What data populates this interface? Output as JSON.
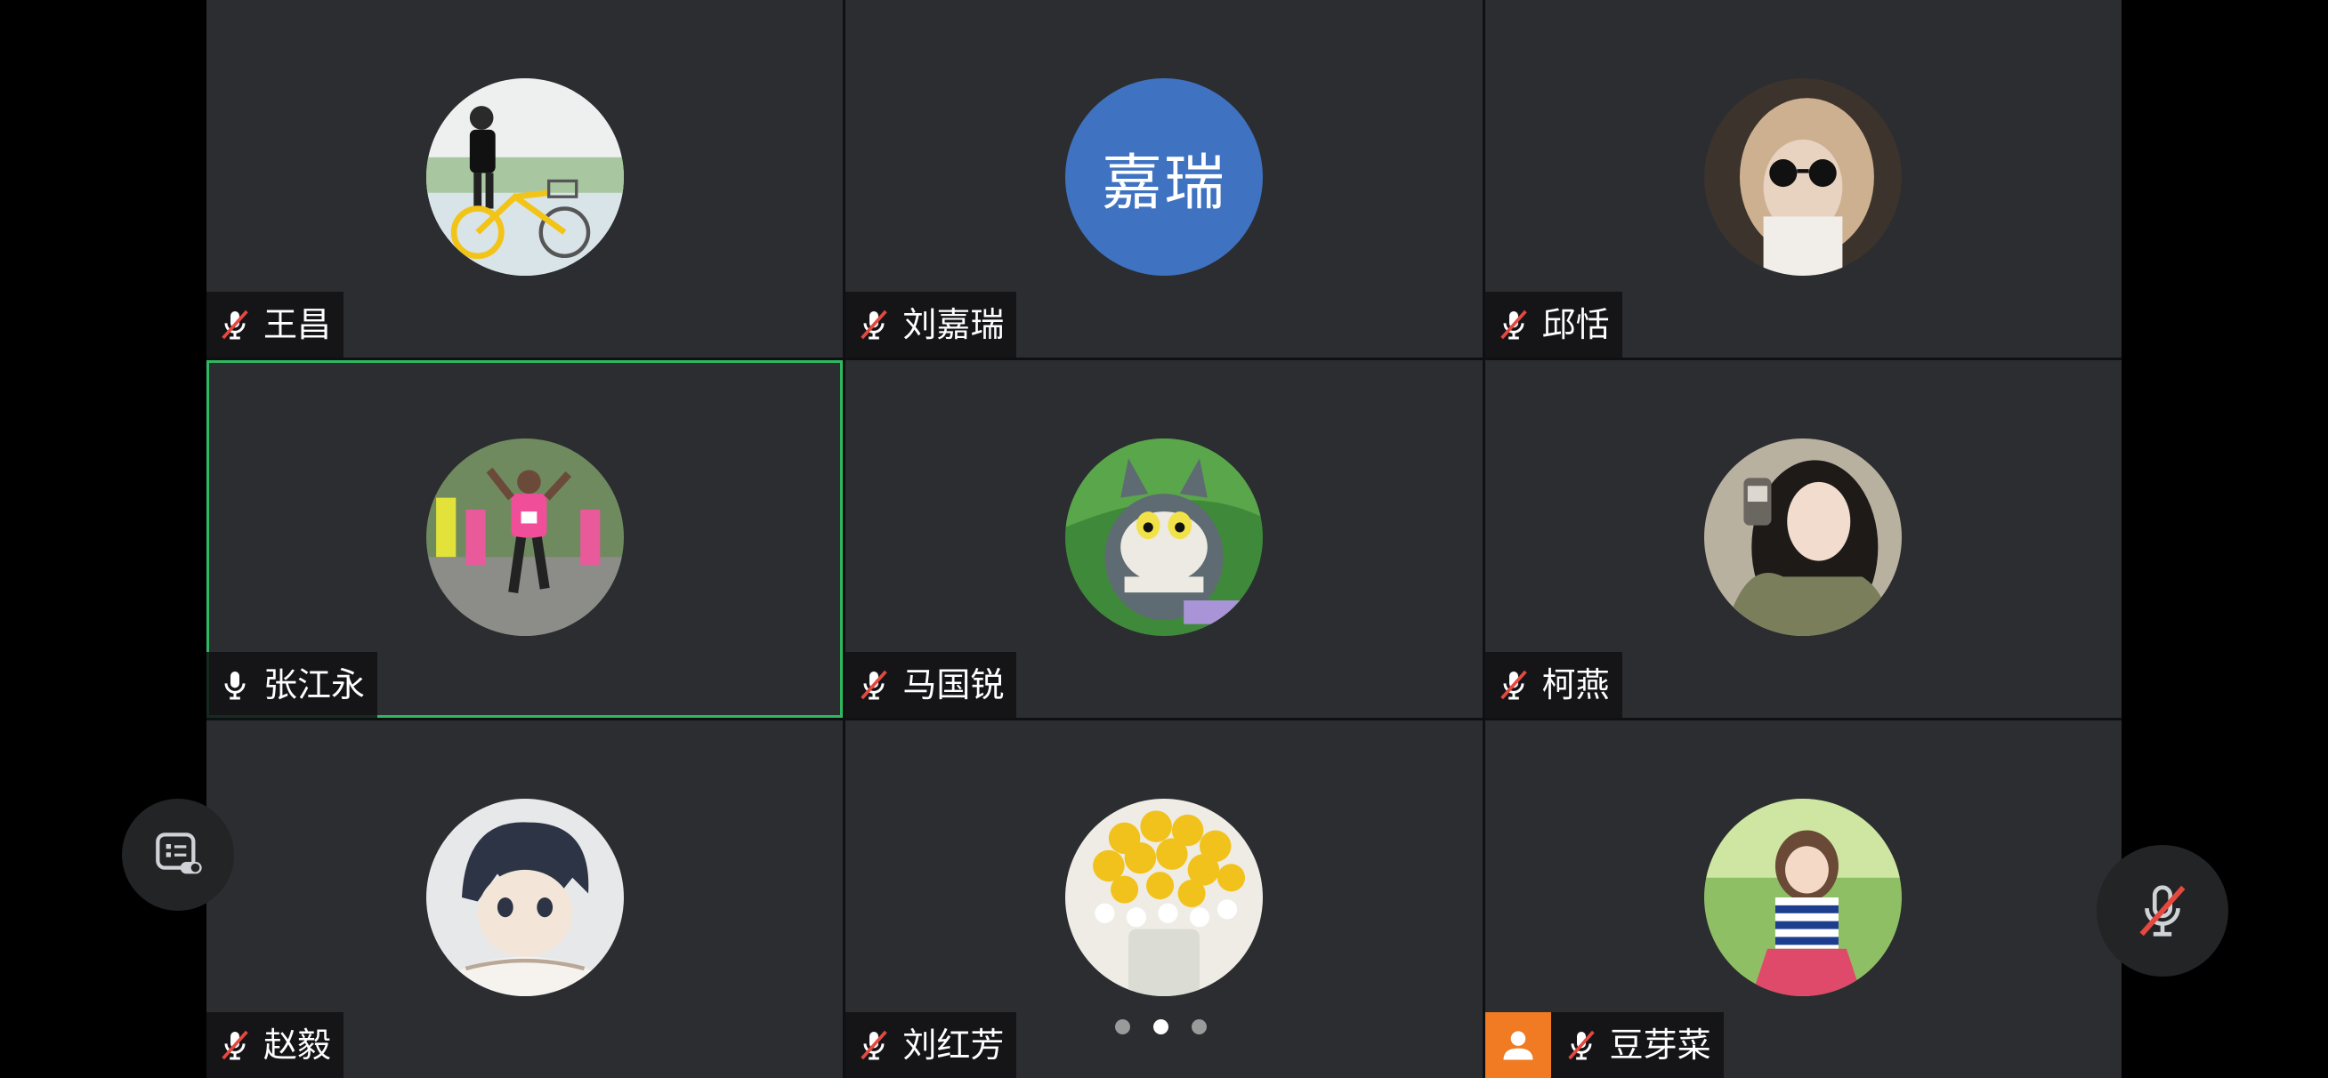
{
  "participants": [
    {
      "name": "王昌",
      "mic": "muted",
      "active": false,
      "avatar_text": ""
    },
    {
      "name": "刘嘉瑞",
      "mic": "muted",
      "active": false,
      "avatar_text": "嘉瑞"
    },
    {
      "name": "邱恬",
      "mic": "muted",
      "active": false,
      "avatar_text": ""
    },
    {
      "name": "张江永",
      "mic": "on",
      "active": true,
      "avatar_text": ""
    },
    {
      "name": "马国锐",
      "mic": "muted",
      "active": false,
      "avatar_text": ""
    },
    {
      "name": "柯燕",
      "mic": "muted",
      "active": false,
      "avatar_text": ""
    },
    {
      "name": "赵毅",
      "mic": "muted",
      "active": false,
      "avatar_text": ""
    },
    {
      "name": "刘红芳",
      "mic": "muted",
      "active": false,
      "avatar_text": ""
    },
    {
      "name": "豆芽菜",
      "mic": "muted",
      "active": false,
      "avatar_text": "",
      "host": true
    }
  ],
  "pager": {
    "pages": 3,
    "current": 2
  },
  "colors": {
    "tile_bg": "#2b2d30",
    "active_border": "#2fb861",
    "muted_red": "#e5483e",
    "host_badge": "#f07b22",
    "initials_avatar": "#3f72c0"
  },
  "icons": {
    "muted": "mic-muted-icon",
    "on": "mic-icon",
    "chat": "chat-toggle-icon",
    "host": "host-person-icon"
  }
}
